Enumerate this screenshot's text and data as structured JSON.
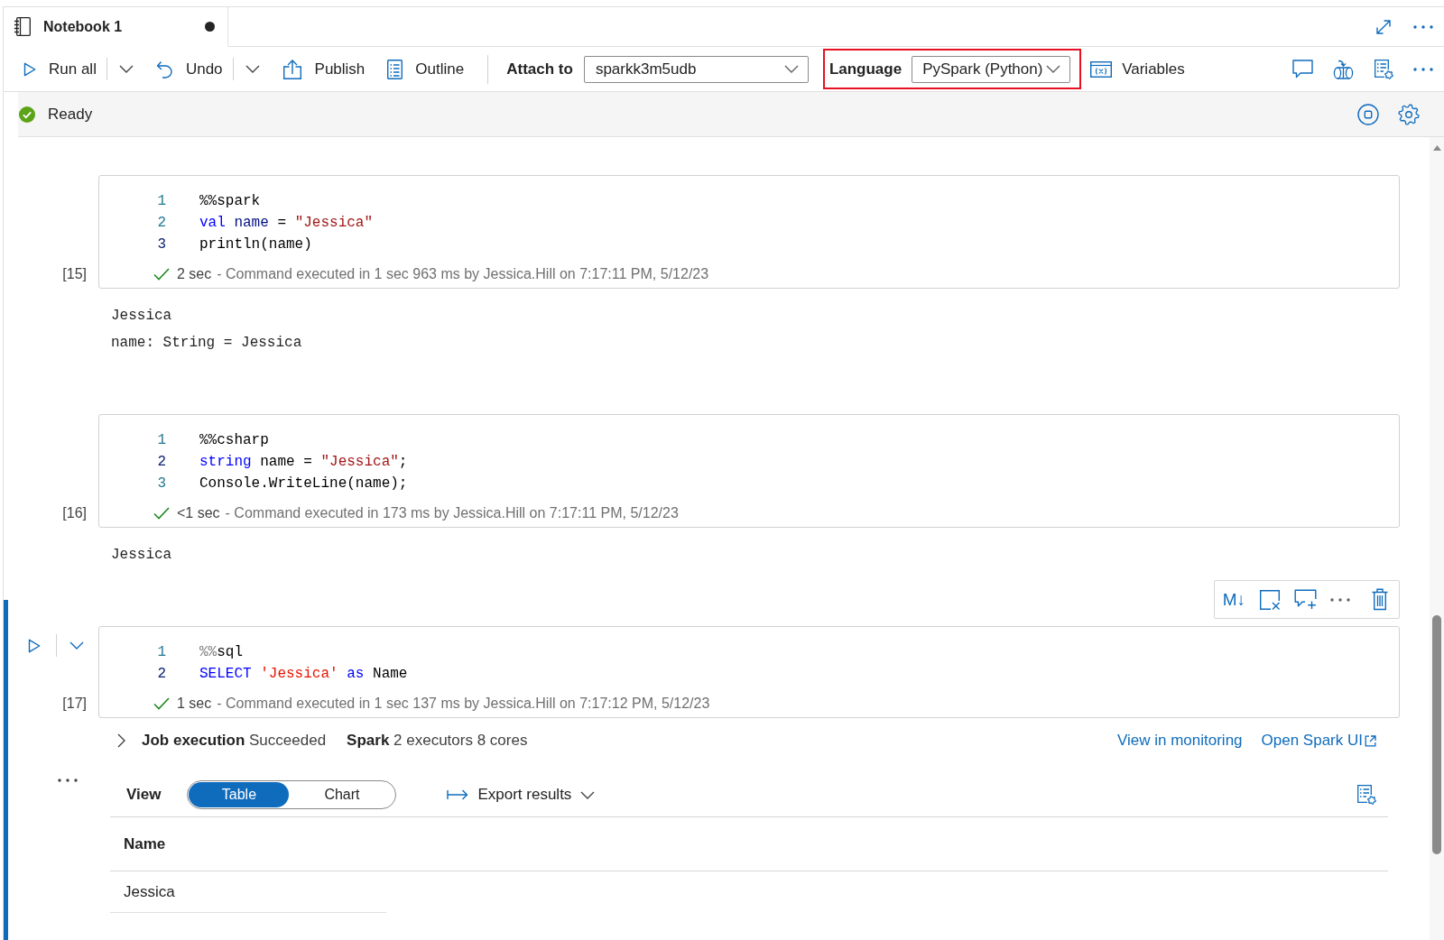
{
  "tabs": [
    {
      "title": "Notebook 1",
      "unsaved": true,
      "selected": true
    }
  ],
  "toolbar": {
    "buttons": [
      {
        "kind": "run",
        "label": "Run all",
        "split": true
      },
      {
        "kind": "undo",
        "label": "Undo",
        "split": true
      },
      {
        "kind": "publish",
        "label": "Publish",
        "split": false
      },
      {
        "kind": "outline",
        "label": "Outline",
        "split": false
      }
    ],
    "attach": {
      "label": "Attach to",
      "value": "sparkk3m5udb"
    },
    "language": {
      "label": "Language",
      "value": "PySpark (Python)",
      "highlighted": true
    },
    "variables": {
      "label": "Variables"
    }
  },
  "status_bar": {
    "ok": true,
    "text": "Ready"
  },
  "cells": [
    {
      "selected": false,
      "execution_count": "[15]",
      "lines": [
        {
          "number": "1",
          "active": false,
          "tokens": [
            {
              "kind": "plain",
              "text": "%%spark"
            }
          ]
        },
        {
          "number": "2",
          "active": false,
          "tokens": [
            {
              "kind": "keyword",
              "text": "val"
            },
            {
              "kind": "identifier",
              "text": " name"
            },
            {
              "kind": "plain",
              "text": " = "
            },
            {
              "kind": "string",
              "text": "\"Jessica\""
            }
          ]
        },
        {
          "number": "3",
          "active": true,
          "tokens": [
            {
              "kind": "plain",
              "text": "println(name)"
            }
          ]
        }
      ],
      "run": {
        "succeeded": true,
        "duration": "2 sec",
        "message": "- Command executed in 1 sec 963 ms by Jessica.Hill on 7:17:11 PM, 5/12/23"
      },
      "output": [
        "Jessica",
        "name: String = Jessica"
      ]
    },
    {
      "selected": false,
      "execution_count": "[16]",
      "lines": [
        {
          "number": "1",
          "active": false,
          "tokens": [
            {
              "kind": "plain",
              "text": "%%csharp"
            }
          ]
        },
        {
          "number": "2",
          "active": true,
          "tokens": [
            {
              "kind": "keyword",
              "text": "string"
            },
            {
              "kind": "plain",
              "text": " name = "
            },
            {
              "kind": "string",
              "text": "\"Jessica\""
            },
            {
              "kind": "plain",
              "text": ";"
            }
          ]
        },
        {
          "number": "3",
          "active": false,
          "tokens": [
            {
              "kind": "plain",
              "text": "Console.WriteLine(name);"
            }
          ]
        }
      ],
      "run": {
        "succeeded": true,
        "duration": "<1 sec",
        "message": "- Command executed in 173 ms by Jessica.Hill on 7:17:11 PM, 5/12/23"
      },
      "output": [
        "Jessica"
      ]
    },
    {
      "selected": true,
      "execution_count": "[17]",
      "cell_toolbar": {
        "markdown": "M↓"
      },
      "lines": [
        {
          "number": "1",
          "active": false,
          "tokens": [
            {
              "kind": "directive",
              "text": "%%"
            },
            {
              "kind": "plain",
              "text": "sql"
            }
          ]
        },
        {
          "number": "2",
          "active": true,
          "tokens": [
            {
              "kind": "keyword",
              "text": "SELECT"
            },
            {
              "kind": "literal",
              "text": " 'Jessica'"
            },
            {
              "kind": "keyword",
              "text": " as"
            },
            {
              "kind": "plain",
              "text": " Name"
            }
          ]
        }
      ],
      "run": {
        "succeeded": true,
        "duration": "1 sec",
        "message": "- Command executed in 1 sec 137 ms by Jessica.Hill on 7:17:12 PM, 5/12/23"
      },
      "result": {
        "job": {
          "expanded": false,
          "text": "**Job execution** Succeeded"
        },
        "spark": {
          "text": "**Spark** 2 executors 8 cores"
        },
        "links": [
          {
            "label": "View in monitoring",
            "external": false
          },
          {
            "label": "Open Spark UI",
            "external": true
          }
        ],
        "view": {
          "label": "View",
          "options": [
            {
              "label": "Table",
              "selected": true
            },
            {
              "label": "Chart",
              "selected": false
            }
          ]
        },
        "export": {
          "label": "Export results"
        },
        "table": {
          "columns": [
            "Name"
          ],
          "rows": [
            [
              "Jessica"
            ]
          ]
        }
      }
    }
  ]
}
